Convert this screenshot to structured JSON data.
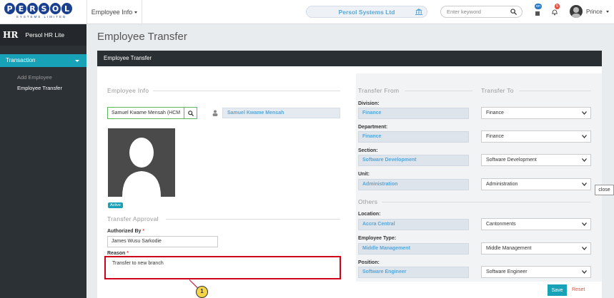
{
  "logo": {
    "letters": [
      "P",
      "E",
      "R",
      "S",
      "O",
      "L"
    ],
    "tagline": "SYSTEMS LIMITED"
  },
  "header": {
    "module_menu": "Employee Info",
    "company": "Persol Systems Ltd",
    "search_placeholder": "Enter keyword",
    "lang_badge": "en",
    "notif_count": "5",
    "user": "Prince"
  },
  "sidebar": {
    "brand_hr": "HR",
    "brand_name": "Persol HR Lite",
    "section": "Transaction",
    "items": [
      {
        "label": "Add Employee",
        "active": false
      },
      {
        "label": "Employee Transfer",
        "active": true
      }
    ]
  },
  "page": {
    "title": "Employee Transfer",
    "panel_title": "Employee Transfer"
  },
  "employee_info": {
    "legend": "Employee Info",
    "search_value": "Samuel Kwame Mensah (HCM",
    "name": "Samuel Kwame Mensah",
    "status": "Active"
  },
  "approval": {
    "legend": "Transfer Approval",
    "authorized_label": "Authorized By",
    "authorized_value": "James Wusu Sarkodie",
    "reason_label": "Reason",
    "reason_value": "Transfer to new branch",
    "required_mark": "*"
  },
  "transfer": {
    "from_legend": "Transfer From",
    "to_legend": "Transfer To",
    "others_legend": "Others",
    "fields": [
      {
        "label": "Division:",
        "from": "Finance",
        "to": "Finance"
      },
      {
        "label": "Department:",
        "from": "Finance",
        "to": "Finance"
      },
      {
        "label": "Section:",
        "from": "Software Development",
        "to": "Software Development"
      },
      {
        "label": "Unit:",
        "from": "Administration",
        "to": "Administration"
      },
      {
        "label": "Location:",
        "from": "Accra Central",
        "to": "Cantonments"
      },
      {
        "label": "Employee Type:",
        "from": "Middle Management",
        "to": "Middle Management"
      },
      {
        "label": "Position:",
        "from": "Software Engineer",
        "to": "Software Engineer"
      }
    ]
  },
  "tooltip": "close",
  "actions": {
    "save": "Save",
    "reset": "Reset"
  },
  "callout_number": "1",
  "colors": {
    "accent": "#17a2b8",
    "highlight": "#d0021b",
    "readonly_text": "#5aa6d6"
  }
}
